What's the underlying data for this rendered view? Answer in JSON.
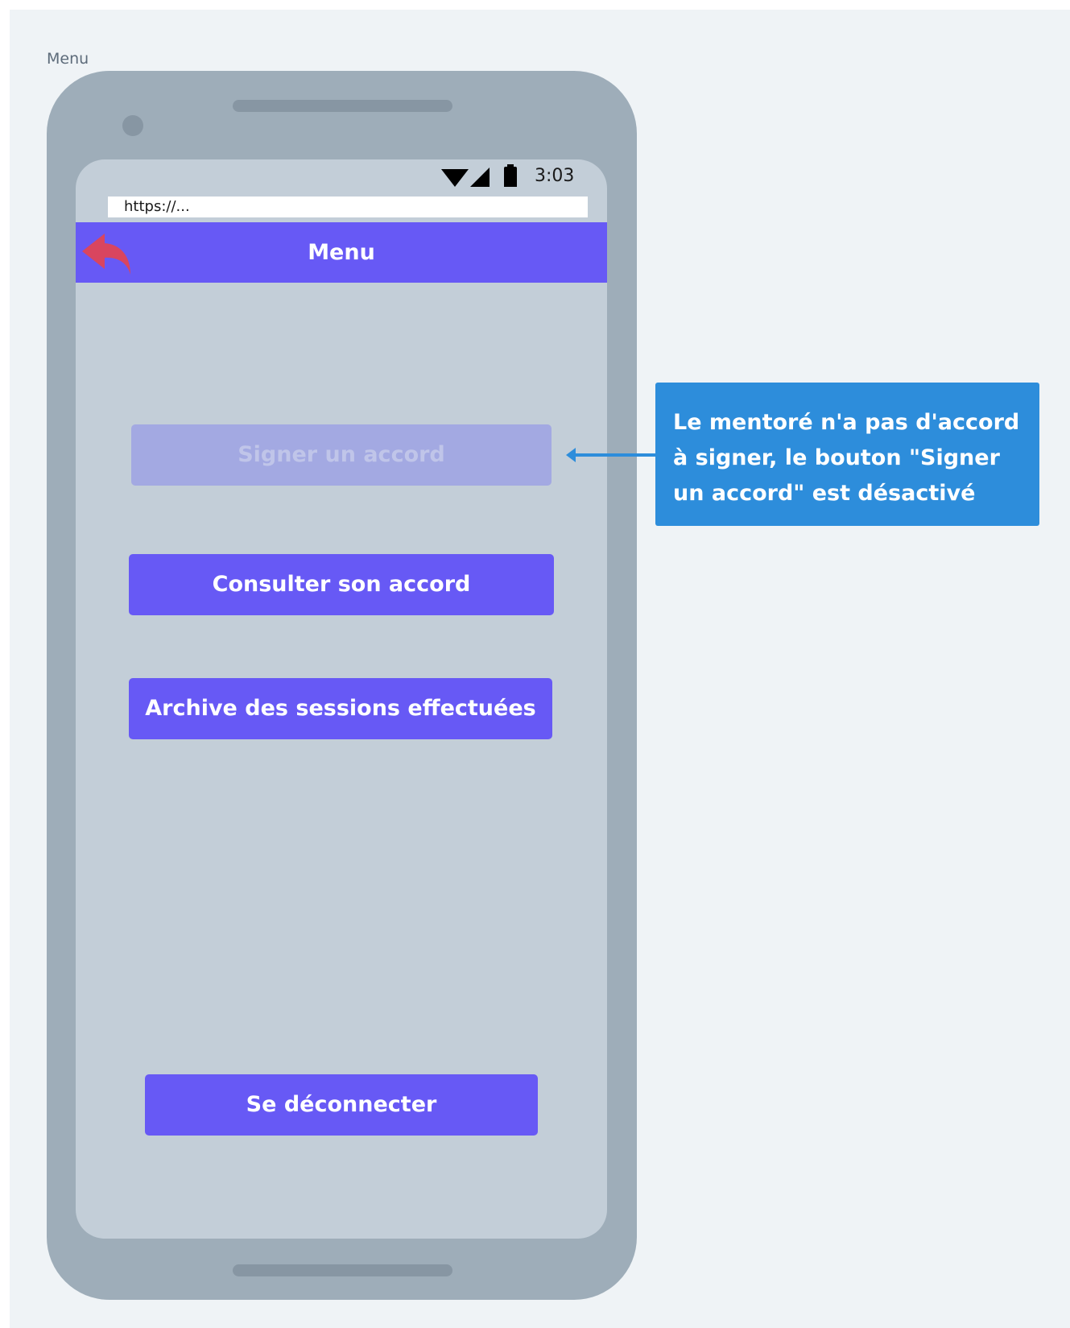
{
  "frame": {
    "label": "Menu"
  },
  "status_bar": {
    "time": "3:03",
    "icons": [
      "wifi-icon",
      "signal-icon",
      "battery-icon"
    ]
  },
  "browser": {
    "url": "https://..."
  },
  "app_bar": {
    "title": "Menu",
    "back_icon": "reply-arrow-icon"
  },
  "menu": {
    "sign_label": "Signer un accord",
    "sign_disabled": true,
    "consult_label": "Consulter son accord",
    "archive_label": "Archive des sessions effectuées",
    "logout_label": "Se déconnecter"
  },
  "annotation": {
    "text": "Le mentoré n'a pas d'accord à signer, le bouton \"Signer un accord\" est désactivé"
  },
  "colors": {
    "background": "#eff3f6",
    "phone_body": "#9eadb9",
    "screen": "#c3ced8",
    "primary": "#6759f5",
    "disabled": "#a3a9e2",
    "back_icon": "#d9455f",
    "annotation": "#2d8ddb"
  }
}
